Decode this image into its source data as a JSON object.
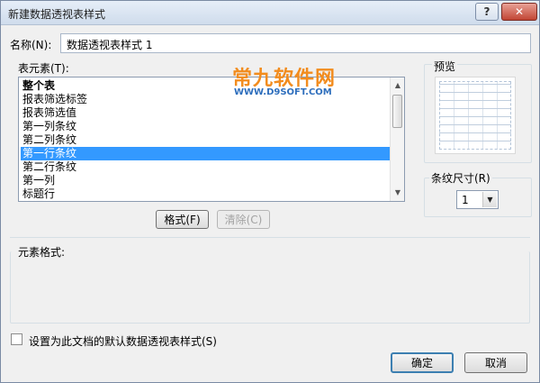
{
  "window": {
    "title": "新建数据透视表样式",
    "help_glyph": "?",
    "close_glyph": "✕"
  },
  "name_field": {
    "label": "名称(N):",
    "value": "数据透视表样式 1"
  },
  "table_elements": {
    "label": "表元素(T):",
    "items": [
      {
        "label": "整个表",
        "bold": true,
        "selected": false
      },
      {
        "label": "报表筛选标签",
        "bold": false,
        "selected": false
      },
      {
        "label": "报表筛选值",
        "bold": false,
        "selected": false
      },
      {
        "label": "第一列条纹",
        "bold": false,
        "selected": false
      },
      {
        "label": "第二列条纹",
        "bold": false,
        "selected": false
      },
      {
        "label": "第一行条纹",
        "bold": false,
        "selected": true
      },
      {
        "label": "第二行条纹",
        "bold": false,
        "selected": false
      },
      {
        "label": "第一列",
        "bold": false,
        "selected": false
      },
      {
        "label": "标题行",
        "bold": false,
        "selected": false
      }
    ]
  },
  "buttons": {
    "format": "格式(F)",
    "clear": "清除(C)",
    "ok": "确定",
    "cancel": "取消"
  },
  "preview": {
    "label": "预览"
  },
  "stripe_size": {
    "label": "条纹尺寸(R)",
    "value": "1"
  },
  "element_format": {
    "label": "元素格式:"
  },
  "default_checkbox": {
    "label": "设置为此文档的默认数据透视表样式(S)",
    "checked": false
  },
  "watermark": {
    "main": "常九软件网",
    "sub": "WWW.D9SOFT.COM"
  },
  "colors": {
    "selection": "#3399ff",
    "watermark_main": "#f28c1e",
    "watermark_sub": "#2f6fbd"
  }
}
